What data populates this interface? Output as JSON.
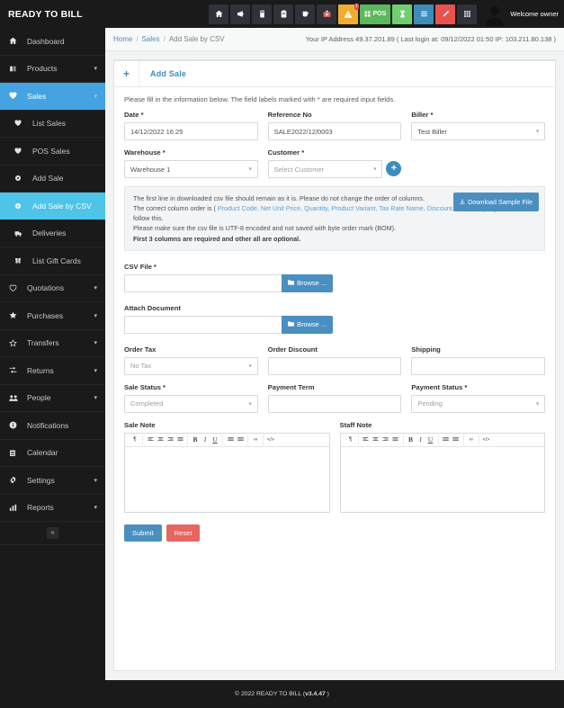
{
  "brand": {
    "title": "READY TO BILL"
  },
  "topnav": {
    "icons": [
      {
        "name": "home-icon",
        "glyph": "home",
        "style": "dark",
        "label": ""
      },
      {
        "name": "megaphone-icon",
        "glyph": "megaphone",
        "style": "dark",
        "label": ""
      },
      {
        "name": "book-icon",
        "glyph": "book",
        "style": "dark",
        "label": ""
      },
      {
        "name": "clipboard-icon",
        "glyph": "clipboard",
        "style": "dark",
        "label": ""
      },
      {
        "name": "cup-icon",
        "glyph": "cup",
        "style": "dark",
        "label": ""
      },
      {
        "name": "medkit-icon",
        "glyph": "medkit",
        "style": "dark",
        "label": ""
      },
      {
        "name": "alert-warning-icon",
        "glyph": "warning",
        "style": "orange",
        "label": "",
        "badge": "1"
      },
      {
        "name": "pos-button",
        "glyph": "grid",
        "style": "green",
        "label": "POS"
      },
      {
        "name": "hourglass-icon",
        "glyph": "hourglass",
        "style": "green2",
        "label": ""
      },
      {
        "name": "list-icon",
        "glyph": "list",
        "style": "blue",
        "label": ""
      },
      {
        "name": "pencil-icon",
        "glyph": "pencil",
        "style": "red",
        "label": ""
      },
      {
        "name": "calculator-icon",
        "glyph": "grid",
        "style": "dark",
        "label": ""
      }
    ],
    "welcome": "Welcome owner"
  },
  "sidebar": {
    "items": [
      {
        "label": "Dashboard",
        "icon": "dashboard-icon",
        "caret": false,
        "state": ""
      },
      {
        "label": "Products",
        "icon": "products-icon",
        "caret": true,
        "state": ""
      },
      {
        "label": "Sales",
        "icon": "heart-icon",
        "caret": true,
        "state": "active"
      },
      {
        "label": "List Sales",
        "icon": "heart-icon",
        "caret": false,
        "state": "sub"
      },
      {
        "label": "POS Sales",
        "icon": "heart-icon",
        "caret": false,
        "state": "sub"
      },
      {
        "label": "Add Sale",
        "icon": "circle-icon",
        "caret": false,
        "state": "sub"
      },
      {
        "label": "Add Sale by CSV",
        "icon": "circle-icon",
        "caret": false,
        "state": "active2 sub"
      },
      {
        "label": "Deliveries",
        "icon": "truck-icon",
        "caret": false,
        "state": "sub"
      },
      {
        "label": "List Gift Cards",
        "icon": "giftcard-icon",
        "caret": false,
        "state": "sub"
      },
      {
        "label": "Quotations",
        "icon": "heart-o-icon",
        "caret": true,
        "state": ""
      },
      {
        "label": "Purchases",
        "icon": "star-icon",
        "caret": true,
        "state": ""
      },
      {
        "label": "Transfers",
        "icon": "star-o-icon",
        "caret": true,
        "state": ""
      },
      {
        "label": "Returns",
        "icon": "exchange-icon",
        "caret": true,
        "state": ""
      },
      {
        "label": "People",
        "icon": "people-icon",
        "caret": true,
        "state": ""
      },
      {
        "label": "Notifications",
        "icon": "info-icon",
        "caret": false,
        "state": ""
      },
      {
        "label": "Calendar",
        "icon": "calendar-icon",
        "caret": false,
        "state": ""
      },
      {
        "label": "Settings",
        "icon": "gear-icon",
        "caret": true,
        "state": ""
      },
      {
        "label": "Reports",
        "icon": "chart-icon",
        "caret": true,
        "state": ""
      }
    ],
    "collapse_glyph": "«"
  },
  "breadcrumb": {
    "home": "Home",
    "sales": "Sales",
    "current": "Add Sale by CSV",
    "separator": "/",
    "ip_info": "Your IP Address 49.37.201.89 ( Last login at: 09/12/2022 01:50 IP: 103.211.80.138 )"
  },
  "panel": {
    "plus": "+",
    "title": "Add Sale",
    "subtitle": "Please fill in the information below. The field labels marked with * are required input fields."
  },
  "form": {
    "date": {
      "label": "Date *",
      "value": "14/12/2022 16:25"
    },
    "reference": {
      "label": "Reference No",
      "value": "SALE2022/12/0003"
    },
    "biller": {
      "label": "Biller *",
      "value": "Test Biller"
    },
    "warehouse": {
      "label": "Warehouse *",
      "value": "Warehouse 1"
    },
    "customer": {
      "label": "Customer *",
      "value": "Select Customer",
      "placeholder": true,
      "add_button": "+"
    },
    "csv_file": {
      "label": "CSV File *",
      "value": "",
      "browse": "Browse ..."
    },
    "attach_document": {
      "label": "Attach Document",
      "value": "",
      "browse": "Browse ..."
    },
    "order_tax": {
      "label": "Order Tax",
      "value": "No Tax"
    },
    "order_discount": {
      "label": "Order Discount",
      "value": ""
    },
    "shipping": {
      "label": "Shipping",
      "value": ""
    },
    "sale_status": {
      "label": "Sale Status *",
      "value": "Completed"
    },
    "payment_term": {
      "label": "Payment Term",
      "value": ""
    },
    "payment_status": {
      "label": "Payment Status *",
      "value": "Pending"
    },
    "sale_note": {
      "label": "Sale Note",
      "value": ""
    },
    "staff_note": {
      "label": "Staff Note",
      "value": ""
    }
  },
  "info_box": {
    "line1": "The first line in downloaded csv file should remain as it is. Please do not change the order of columns.",
    "line2_pre": "The correct column order is (",
    "line2_cols": " Product Code, Net Unit Price, Quantity, Product Variant, Tax Rate Name, Discount, Serial No ",
    "line2_post": ") & you must follow this.",
    "line3": "Please make sure the csv file is UTF-8 encoded and not saved with byte order mark (BOM).",
    "line4": "First 3 columns are required and other all are optional.",
    "download_button": "Download Sample File"
  },
  "editor_toolbar": {
    "buttons": [
      {
        "name": "paragraph-icon",
        "glyph": "¶"
      },
      {
        "name": "align-left-icon",
        "glyph": "align-left"
      },
      {
        "name": "align-center-icon",
        "glyph": "align-center"
      },
      {
        "name": "align-right-icon",
        "glyph": "align-right"
      },
      {
        "name": "align-justify-icon",
        "glyph": "align-justify"
      },
      {
        "name": "bold-icon",
        "glyph": "B"
      },
      {
        "name": "italic-icon",
        "glyph": "I"
      },
      {
        "name": "underline-icon",
        "glyph": "U"
      },
      {
        "name": "unordered-list-icon",
        "glyph": "ul"
      },
      {
        "name": "ordered-list-icon",
        "glyph": "ol"
      },
      {
        "name": "link-icon",
        "glyph": "∞"
      },
      {
        "name": "code-icon",
        "glyph": "</>"
      }
    ]
  },
  "actions": {
    "submit": "Submit",
    "reset": "Reset"
  },
  "footer": {
    "text": "© 2022 READY TO BILL (",
    "version": "v3.4.47",
    "text_end": " )"
  },
  "colors": {
    "sidebar_bg": "#1a1a1a",
    "accent_blue": "#3c8dbc",
    "active_blue": "#44a3e0",
    "active_cyan": "#4dc4e8",
    "submit_blue": "#4a8fc0",
    "reset_red": "#e8645f",
    "green": "#5cb85c",
    "orange": "#f0ad2e"
  }
}
